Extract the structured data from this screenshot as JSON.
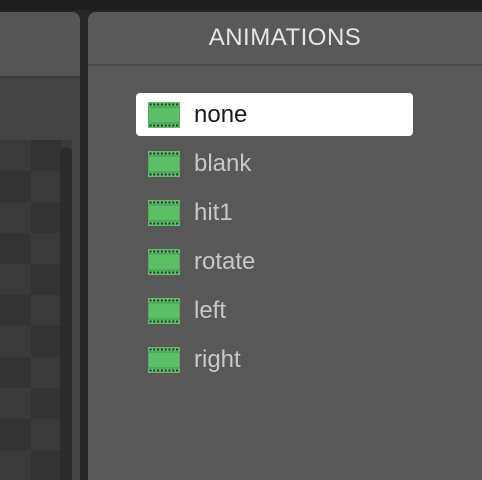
{
  "panel": {
    "title": "ANIMATIONS"
  },
  "animations": [
    {
      "label": "none",
      "selected": true
    },
    {
      "label": "blank",
      "selected": false
    },
    {
      "label": "hit1",
      "selected": false
    },
    {
      "label": "rotate",
      "selected": false
    },
    {
      "label": "left",
      "selected": false
    },
    {
      "label": "right",
      "selected": false
    }
  ],
  "icons": {
    "animation_item": "film-strip-icon"
  },
  "colors": {
    "icon_green": "#5cbf68",
    "selected_bg": "#ffffff",
    "panel_bg": "#585858",
    "text": "#c8c8c8"
  }
}
